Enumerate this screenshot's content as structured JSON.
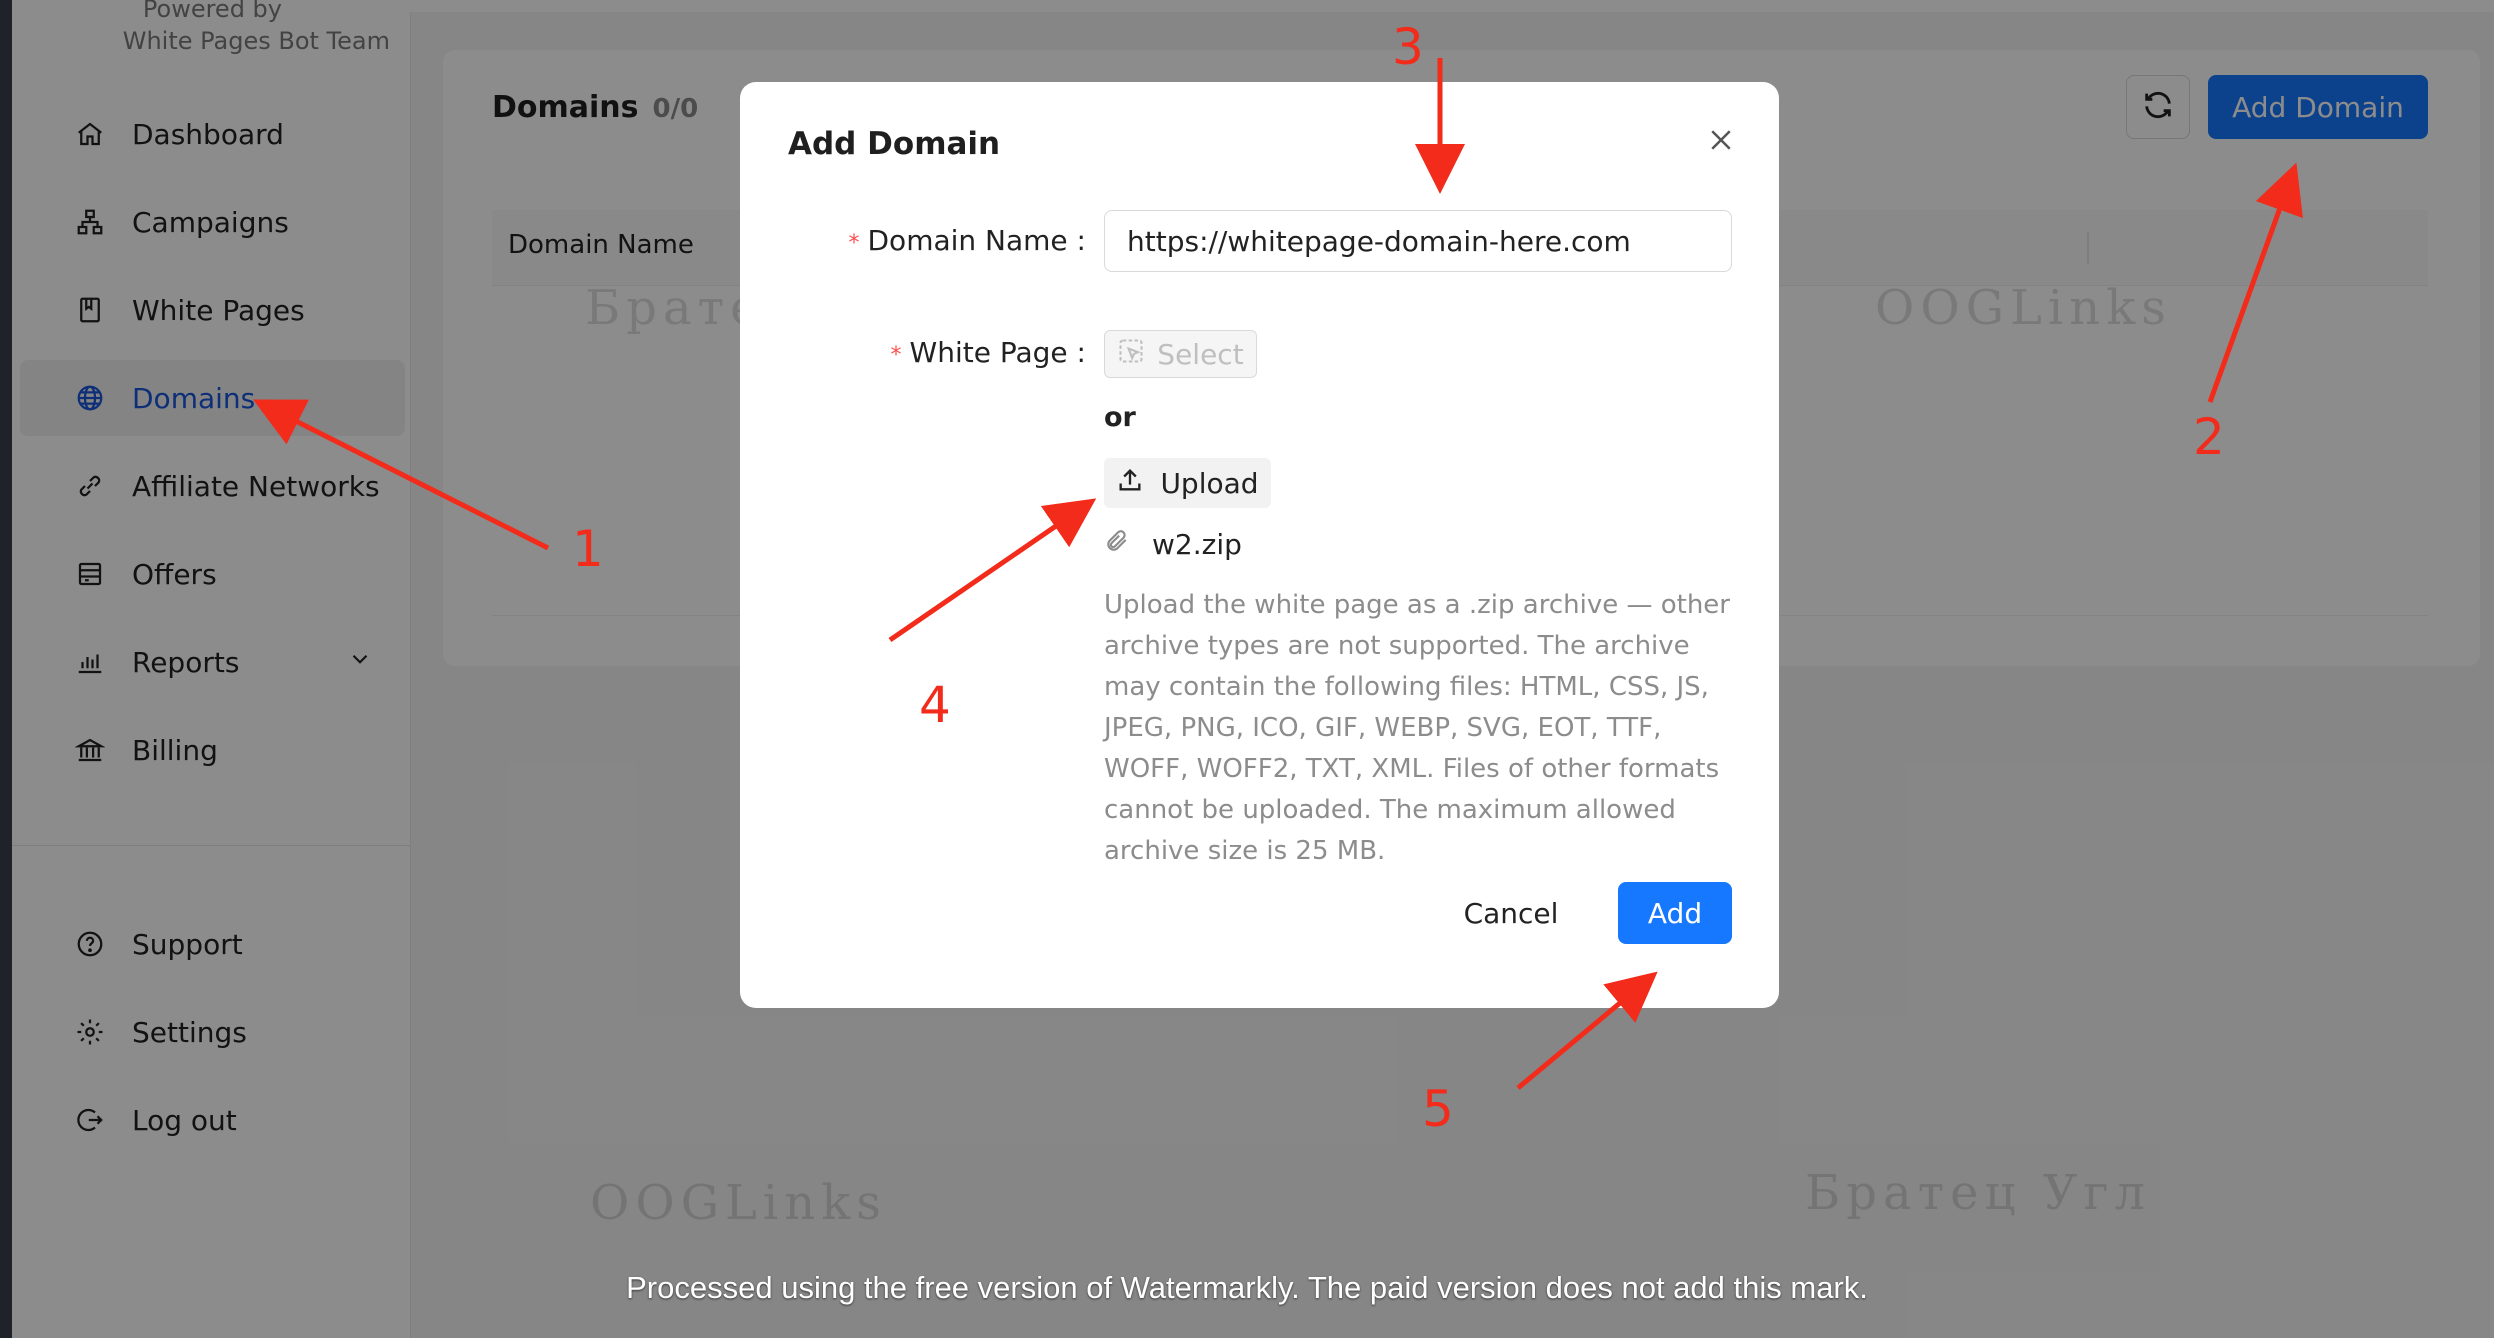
{
  "sidebar": {
    "powered_line1": "Powered by",
    "powered_line2": "White Pages Bot Team",
    "items": [
      {
        "label": "Dashboard",
        "icon": "home-icon"
      },
      {
        "label": "Campaigns",
        "icon": "sitemap-icon"
      },
      {
        "label": "White Pages",
        "icon": "book-icon"
      },
      {
        "label": "Domains",
        "icon": "globe-icon",
        "active": true
      },
      {
        "label": "Affiliate Networks",
        "icon": "link-icon"
      },
      {
        "label": "Offers",
        "icon": "offers-icon"
      },
      {
        "label": "Reports",
        "icon": "bar-chart-icon"
      },
      {
        "label": "Billing",
        "icon": "bank-icon"
      }
    ],
    "bottom_items": [
      {
        "label": "Support",
        "icon": "question-icon"
      },
      {
        "label": "Settings",
        "icon": "gear-icon"
      },
      {
        "label": "Log out",
        "icon": "logout-icon"
      }
    ]
  },
  "main": {
    "title": "Domains",
    "count": "0/0",
    "add_button": "Add Domain",
    "table": {
      "columns": [
        "Domain Name"
      ]
    }
  },
  "modal": {
    "title": "Add Domain",
    "domain_label": "Domain Name",
    "domain_value": "https://whitepage-domain-here.com",
    "white_page_label": "White Page",
    "select_label": "Select",
    "or_text": "or",
    "upload_label": "Upload",
    "file_name": "w2.zip",
    "hint": "Upload the white page as a .zip archive — other archive types are not supported. The archive may contain the following files: HTML, CSS, JS, JPEG, PNG, ICO, GIF, WEBP, SVG, EOT, TTF, WOFF, WOFF2, TXT, XML. Files of other formats cannot be uploaded. The maximum allowed archive size is 25 MB.",
    "cancel_label": "Cancel",
    "add_label": "Add"
  },
  "annotations": [
    "1",
    "2",
    "3",
    "4",
    "5"
  ],
  "watermarks": {
    "w1": "Братец Угл",
    "w2": "OOGLinks",
    "w3": "OOGLinks",
    "w4": "Братец Угл",
    "footer": "Processed using the free version of Watermarkly. The paid version does not add this mark."
  },
  "colors": {
    "accent": "#1677ff",
    "annotation": "#f22b1b",
    "active_text": "#1a56db",
    "required": "#ff4d4f"
  }
}
